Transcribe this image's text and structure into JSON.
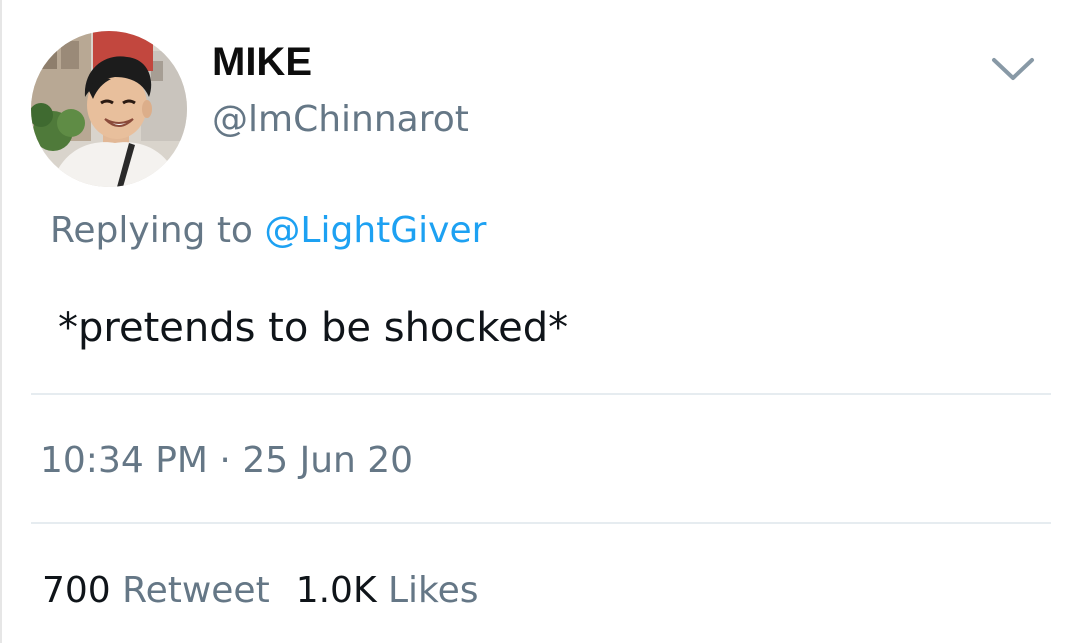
{
  "author": {
    "display_name": "MIKE",
    "handle": "@lmChinnarot",
    "avatar_icon": "profile-photo-avatar"
  },
  "menu": {
    "caret_icon": "chevron-down-icon"
  },
  "reply": {
    "prefix": "Replying to",
    "mention": "@LightGiver"
  },
  "tweet": {
    "text": "*pretends to be shocked*"
  },
  "meta": {
    "time": "10:34 PM",
    "separator": "·",
    "date": "25 Jun 20"
  },
  "stats": {
    "retweets_count": "700",
    "retweets_label": "Retweet",
    "likes_count": "1.0K",
    "likes_label": "Likes"
  },
  "colors": {
    "text": "#0f1419",
    "secondary": "#657786",
    "link": "#1da1f2",
    "divider": "#e6ecf0"
  }
}
